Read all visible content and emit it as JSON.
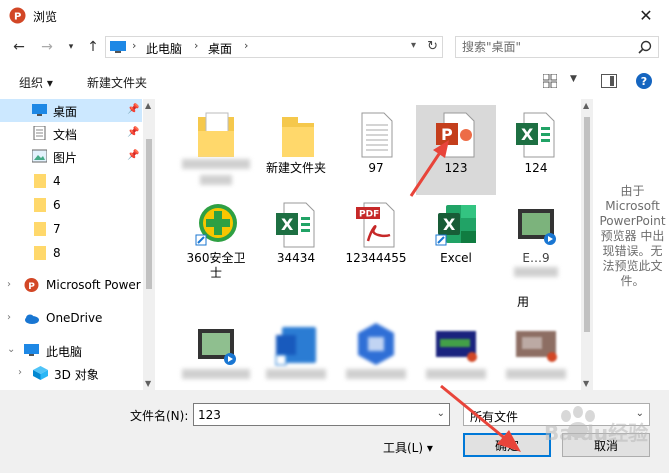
{
  "window": {
    "title": "浏览"
  },
  "address": {
    "crumbs": [
      "此电脑",
      "桌面"
    ]
  },
  "search": {
    "placeholder": "搜索\"桌面\""
  },
  "toolbar": {
    "organize": "组织 ▾",
    "new_folder": "新建文件夹"
  },
  "nav": {
    "items": [
      {
        "label": "桌面",
        "icon": "desktop-icon",
        "selected": true,
        "pinned": true
      },
      {
        "label": "文档",
        "icon": "document-icon",
        "pinned": true
      },
      {
        "label": "图片",
        "icon": "picture-icon",
        "pinned": true
      },
      {
        "label": "4",
        "icon": "folder-icon"
      },
      {
        "label": "6",
        "icon": "folder-icon"
      },
      {
        "label": "7",
        "icon": "folder-icon"
      },
      {
        "label": "8",
        "icon": "folder-icon"
      },
      {
        "label": "Microsoft Power",
        "icon": "powerpoint-icon"
      },
      {
        "label": "OneDrive",
        "icon": "onedrive-icon"
      },
      {
        "label": "此电脑",
        "icon": "pc-icon"
      },
      {
        "label": "3D 对象",
        "icon": "3d-objects-icon"
      }
    ]
  },
  "files": [
    {
      "name": "",
      "icon": "folder-docs-icon"
    },
    {
      "name": "新建文件夹",
      "icon": "folder-icon"
    },
    {
      "name": "97",
      "icon": "text-file-icon"
    },
    {
      "name": "123",
      "icon": "powerpoint-file-icon",
      "selected": true
    },
    {
      "name": "124",
      "icon": "excel-file-icon"
    },
    {
      "name": "360安全卫士",
      "icon": "360-icon"
    },
    {
      "name": "34434",
      "icon": "excel-file-icon"
    },
    {
      "name": "12344455",
      "icon": "pdf-file-icon"
    },
    {
      "name": "Excel",
      "icon": "excel-app-icon"
    },
    {
      "name": "E…9",
      "icon": "video-file-icon"
    },
    {
      "name": "",
      "icon": "video-file-icon"
    },
    {
      "name": "",
      "icon": "word-icon"
    },
    {
      "name": "",
      "icon": "app-icon"
    },
    {
      "name": "",
      "icon": "image-file-icon"
    },
    {
      "name": "",
      "icon": "image-file-icon"
    }
  ],
  "extra_label": "用",
  "preview": {
    "text": [
      "由于",
      "Microsoft",
      "PowerPoint",
      "预览器 中出",
      "现错误。无",
      "法预览此文",
      "件。"
    ]
  },
  "bottom": {
    "filename_label": "文件名(N):",
    "filename_value": "123",
    "filetype_value": "所有文件",
    "tools_label": "工具(L)  ▾",
    "ok_label": "确定",
    "cancel_label": "取消"
  },
  "watermark": {
    "text": "Baidu经验"
  },
  "colors": {
    "accent": "#0078d7",
    "selection": "#cce8ff",
    "annotation": "#e8443a"
  }
}
